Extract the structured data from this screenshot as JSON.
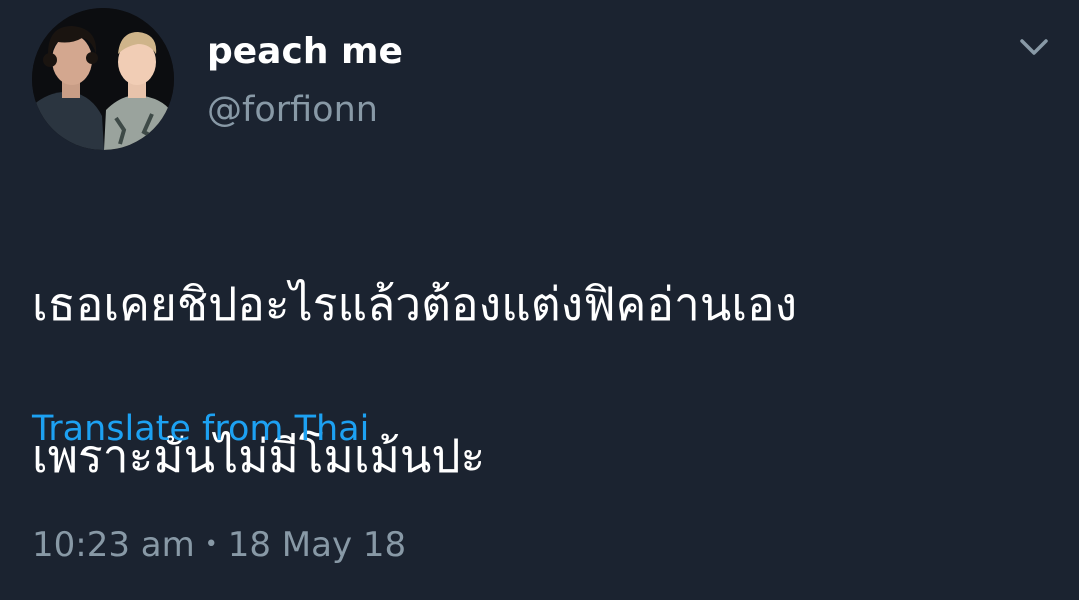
{
  "tweet": {
    "display_name": "peach me",
    "handle": "@forfionn",
    "text_line_1": "เธอเคยชิปอะไรแล้วต้องแต่งฟิคอ่านเอง",
    "text_line_2": "เพราะมันไม่มีโมเม้นปะ",
    "translate_label": "Translate from Thai",
    "time": "10:23 am",
    "separator": "•",
    "date": "18 May 18"
  },
  "icons": {
    "menu": "chevron-down-icon",
    "avatar": "avatar"
  },
  "colors": {
    "background": "#1b2330",
    "text": "#ffffff",
    "secondary": "#8899a6",
    "link": "#1da1f2"
  }
}
